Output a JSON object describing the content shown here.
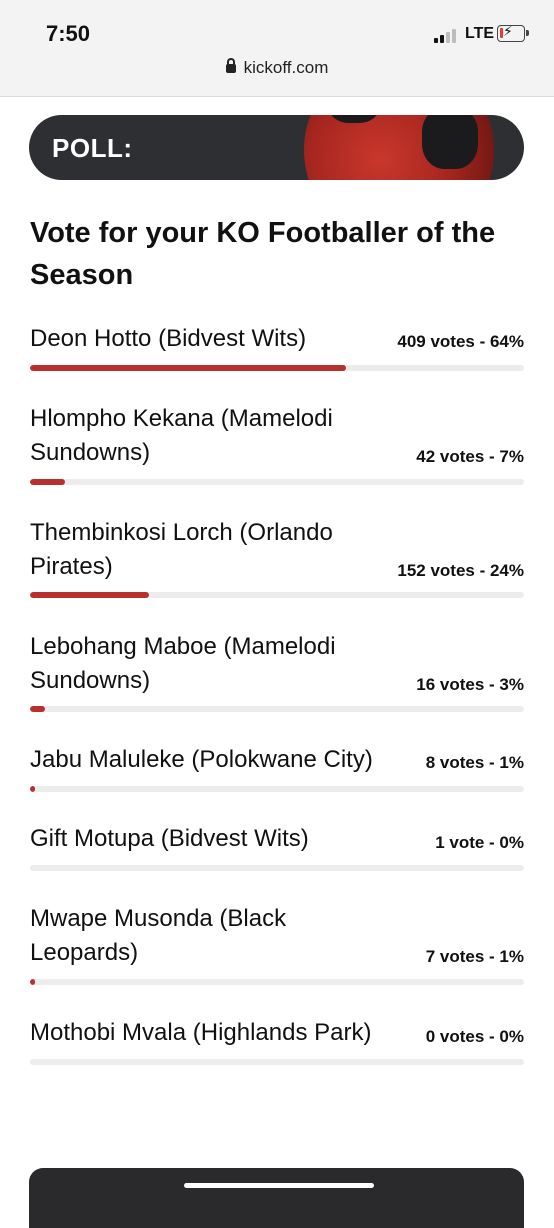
{
  "status_bar": {
    "time": "7:50",
    "network": "LTE",
    "url": "kickoff.com"
  },
  "banner": {
    "label": "POLL:"
  },
  "poll": {
    "question": "Vote for your KO Footballer of the Season",
    "options": [
      {
        "name": "Deon Hotto (Bidvest Wits)",
        "votes_text": "409 votes - 64%",
        "percent": 64
      },
      {
        "name": "Hlompho Kekana (Mamelodi Sundowns)",
        "votes_text": "42 votes - 7%",
        "percent": 7
      },
      {
        "name": "Thembinkosi Lorch (Orlando Pirates)",
        "votes_text": "152 votes - 24%",
        "percent": 24
      },
      {
        "name": "Lebohang Maboe (Mamelodi Sundowns)",
        "votes_text": "16 votes - 3%",
        "percent": 3
      },
      {
        "name": "Jabu Maluleke (Polokwane City)",
        "votes_text": "8 votes - 1%",
        "percent": 1
      },
      {
        "name": "Gift Motupa (Bidvest Wits)",
        "votes_text": "1 vote - 0%",
        "percent": 0
      },
      {
        "name": "Mwape Musonda (Black Leopards)",
        "votes_text": "7 votes - 1%",
        "percent": 1
      },
      {
        "name": "Mothobi Mvala (Highlands Park)",
        "votes_text": "0 votes - 0%",
        "percent": 0
      }
    ]
  },
  "colors": {
    "accent": "#b8302c",
    "banner_bg": "#2e2f33",
    "track": "#ececec"
  },
  "icons": [
    "lock-icon",
    "signal-icon",
    "battery-icon",
    "football-icon"
  ]
}
